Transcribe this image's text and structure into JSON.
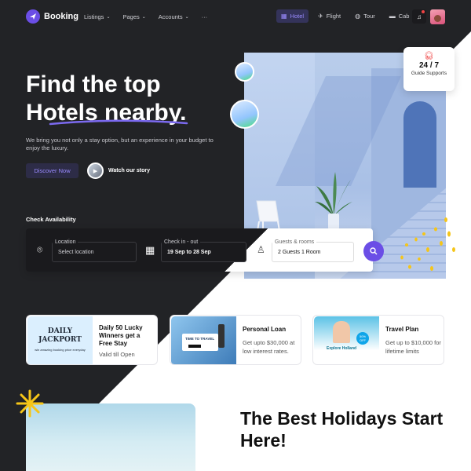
{
  "brand": {
    "name": "Booking"
  },
  "nav": {
    "menu": [
      "Listings",
      "Pages",
      "Accounts"
    ],
    "more": "···",
    "services": [
      {
        "label": "Hotel",
        "icon": "hotel-icon",
        "active": true
      },
      {
        "label": "Flight",
        "icon": "plane-icon",
        "active": false
      },
      {
        "label": "Tour",
        "icon": "globe-icon",
        "active": false
      },
      {
        "label": "Cab",
        "icon": "car-icon",
        "active": false
      }
    ]
  },
  "hero": {
    "title_line1": "Find the top",
    "title_line2": "Hotels nearby.",
    "description": "We bring you not only a stay option, but an experience in your budget to enjoy the luxury.",
    "discover_label": "Discover Now",
    "watch_label": "Watch our story"
  },
  "support": {
    "number": "24 / 7",
    "label": "Guide Supports"
  },
  "availability": {
    "title": "Check Availability",
    "location_label": "Location",
    "location_placeholder": "Select location",
    "checkin_label": "Check in - out",
    "checkin_value": "19 Sep to 28 Sep",
    "guests_label": "Guests & rooms",
    "guests_value": "2 Guests 1 Room"
  },
  "cards": [
    {
      "image_line1": "DAILY",
      "image_line2": "JACKPORT",
      "image_caption": "win amazing booking price everyday",
      "title": "Daily 50 Lucky Winners get a Free Stay",
      "description": "Valid till Open"
    },
    {
      "image_text": "TIME TO TRAVEL",
      "title": "Personal Loan",
      "description": "Get upto $30,000 at low interest rates."
    },
    {
      "image_text": "Explore Holland",
      "image_badge": "50% OFF",
      "title": "Travel Plan",
      "description": "Get up to $10,000 for lifetime limits"
    }
  ],
  "bottom": {
    "title": "The Best Holidays Start Here!"
  }
}
